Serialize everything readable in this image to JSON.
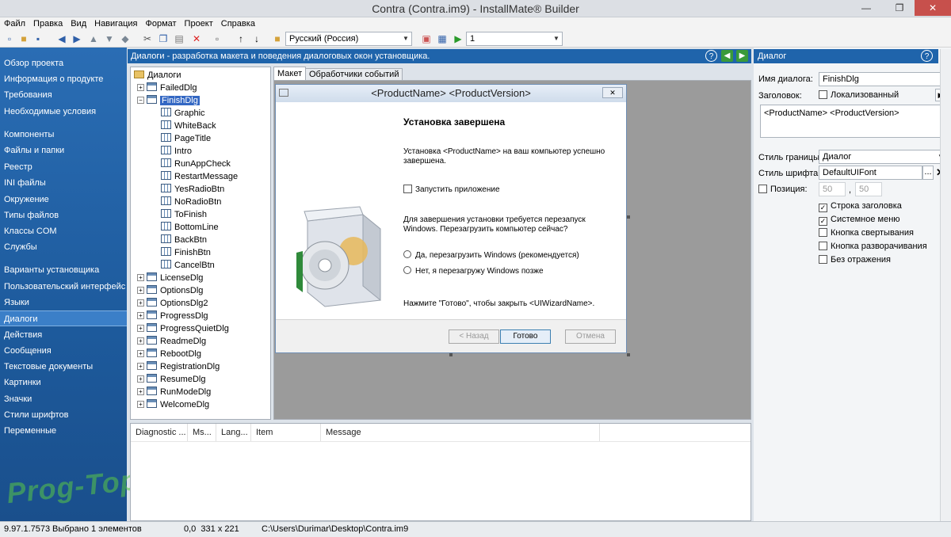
{
  "window": {
    "title": "Contra (Contra.im9) - InstallMate® Builder",
    "min": "—",
    "max": "❐",
    "close": "✕"
  },
  "menu": [
    "Файл",
    "Правка",
    "Вид",
    "Навигация",
    "Формат",
    "Проект",
    "Справка"
  ],
  "toolbar": {
    "language": "Русский (Россия)",
    "build": "1"
  },
  "sidebar": [
    "Обзор проекта",
    "Информация о продукте",
    "Требования",
    "Необходимые условия",
    "Компоненты",
    "Файлы и папки",
    "Реестр",
    "INI файлы",
    "Окружение",
    "Типы файлов",
    "Классы COM",
    "Службы",
    "Варианты установщика",
    "Пользовательский интерфейс",
    "Языки",
    "Диалоги",
    "Действия",
    "Сообщения",
    "Текстовые документы",
    "Картинки",
    "Значки",
    "Стили шрифтов",
    "Переменные"
  ],
  "sidebar_active": "Диалоги",
  "panel": {
    "header": "Диалоги - разработка макета и поведения диалоговых окон установщика."
  },
  "tree": {
    "root": "Диалоги",
    "items": [
      "FailedDlg",
      "FinishDlg",
      "LicenseDlg",
      "OptionsDlg",
      "OptionsDlg2",
      "ProgressDlg",
      "ProgressQuietDlg",
      "ReadmeDlg",
      "RebootDlg",
      "RegistrationDlg",
      "ResumeDlg",
      "RunModeDlg",
      "WelcomeDlg"
    ],
    "children": [
      "Graphic",
      "WhiteBack",
      "PageTitle",
      "Intro",
      "RunAppCheck",
      "RestartMessage",
      "YesRadioBtn",
      "NoRadioBtn",
      "ToFinish",
      "BottomLine",
      "BackBtn",
      "FinishBtn",
      "CancelBtn"
    ]
  },
  "tabs": [
    "Макет",
    "Обработчики событий"
  ],
  "dialog": {
    "title": "<ProductName> <ProductVersion>",
    "heading": "Установка завершена",
    "intro1": "Установка <ProductName> на ваш компьютер успешно",
    "intro2": "завершена.",
    "run_app": "Запустить приложение",
    "reboot1": "Для завершения установки требуется перезапуск",
    "reboot2": "Windows. Перезагрузить компьютер сейчас?",
    "yes": "Да, перезагрузить Windows (рекомендуется)",
    "no": "Нет, я перезагружу Windows позже",
    "finish_note": "Нажмите \"Готово\", чтобы закрыть <UIWizardName>.",
    "back": "< Назад",
    "finish": "Готово",
    "cancel": "Отмена"
  },
  "messages": {
    "columns": [
      "Diagnostic ...",
      "Ms...",
      "Lang...",
      "Item",
      "Message"
    ]
  },
  "props": {
    "header": "Диалог",
    "name_label": "Имя диалога:",
    "name_value": "FinishDlg",
    "caption_label": "Заголовок:",
    "localized": "Локализованный",
    "caption_value": "<ProductName> <ProductVersion>",
    "border_label": "Стиль границы:",
    "border_value": "Диалог",
    "font_label": "Стиль шрифта:",
    "font_value": "DefaultUIFont",
    "font_btn": "...",
    "font_clear": "✕",
    "pos_label": "Позиция:",
    "pos_x": "50",
    "pos_y": "50",
    "checks": [
      "Строка заголовка",
      "Системное меню",
      "Кнопка свертывания",
      "Кнопка разворачивания",
      "Без отражения"
    ],
    "checked": [
      true,
      true,
      false,
      false,
      false
    ]
  },
  "status": {
    "version": "9.97.1.7573",
    "selection": "Выбрано 1 элементов",
    "coords": "0,0  331 x 221",
    "path": "C:\\Users\\Durimar\\Desktop\\Contra.im9"
  },
  "watermark": "Prog-Top.net",
  "colors": {
    "accent": "#1f64ab",
    "sidebar": "#2a6db4",
    "selection": "#3367c3"
  }
}
